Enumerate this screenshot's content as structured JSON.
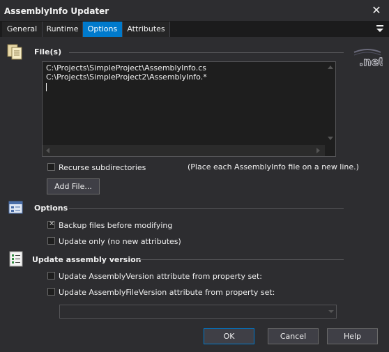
{
  "window": {
    "title": "AssemblyInfo Updater"
  },
  "tabs": [
    {
      "label": "General"
    },
    {
      "label": "Runtime"
    },
    {
      "label": "Options"
    },
    {
      "label": "Attributes"
    }
  ],
  "files": {
    "label": "File(s)",
    "lines": [
      "C:\\Projects\\SimpleProject\\AssemblyInfo.cs",
      "C:\\Projects\\SimpleProject2\\AssemblyInfo.*"
    ],
    "recurse_label": "Recurse subdirectories",
    "recurse_checked": false,
    "hint": "(Place each AssemblyInfo file on a new line.)",
    "add_button": "Add File...",
    "logo_text": ".net"
  },
  "options": {
    "label": "Options",
    "backup_label": "Backup files before modifying",
    "backup_checked": true,
    "update_only_label": "Update only (no new attributes)",
    "update_only_checked": false
  },
  "version": {
    "label": "Update assembly version",
    "assembly_version_label": "Update AssemblyVersion attribute from property set:",
    "assembly_version_checked": false,
    "file_version_label": "Update AssemblyFileVersion attribute from property set:",
    "file_version_checked": false,
    "property_set_value": ""
  },
  "buttons": {
    "ok": "OK",
    "cancel": "Cancel",
    "help": "Help"
  },
  "colors": {
    "accent": "#007acc",
    "background": "#2d2d30",
    "field": "#1e1e1e"
  }
}
